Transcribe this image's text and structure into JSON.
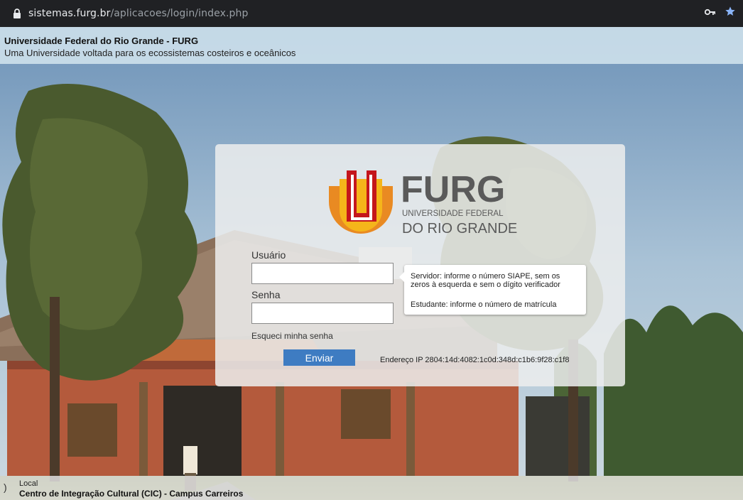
{
  "browser": {
    "domain": "sistemas.furg.br",
    "path": "/aplicacoes/login/index.php"
  },
  "header": {
    "title": "Universidade Federal do Rio Grande - FURG",
    "subtitle": "Uma Universidade voltada para os ecossistemas costeiros e oceânicos"
  },
  "logo": {
    "name": "FURG",
    "line1": "UNIVERSIDADE FEDERAL",
    "line2": "DO RIO GRANDE"
  },
  "form": {
    "user_label": "Usuário",
    "user_value": "",
    "password_label": "Senha",
    "password_value": "",
    "forgot_link": "Esqueci minha senha",
    "submit_label": "Enviar",
    "ip_text": "Endereço IP 2804:14d:4082:1c0d:348d:c1b6:9f28:c1f8"
  },
  "tooltip": {
    "server": "Servidor: informe o número SIAPE, sem os zeros à esquerda e sem o dígito verificador",
    "student": "Estudante: informe o número de matrícula"
  },
  "footer": {
    "label": "Local",
    "location": "Centro de Integração Cultural (CIC) - Campus Carreiros"
  },
  "colors": {
    "accent": "#3e7cc2",
    "logo_orange": "#e98a22",
    "logo_yellow": "#f5b51a",
    "logo_red": "#c4161c",
    "logo_text": "#5a5a5a"
  }
}
